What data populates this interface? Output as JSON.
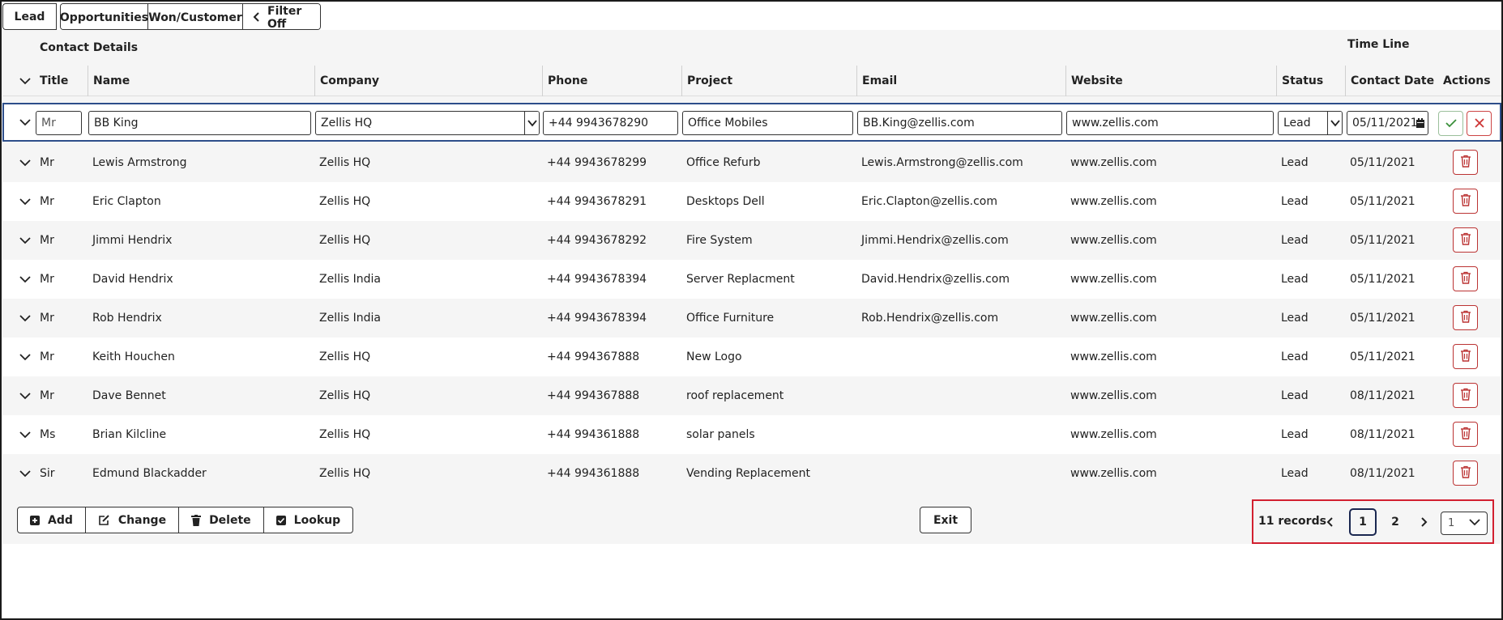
{
  "tabs": {
    "lead": "Lead",
    "opportunities": "Opportunities",
    "won": "Won/Customer",
    "filter": "Filter Off"
  },
  "groups": {
    "contact_details": "Contact Details",
    "time_line": "Time Line"
  },
  "headers": {
    "title": "Title",
    "name": "Name",
    "company": "Company",
    "phone": "Phone",
    "project": "Project",
    "email": "Email",
    "website": "Website",
    "status": "Status",
    "contact_date": "Contact Date",
    "actions": "Actions"
  },
  "edit": {
    "title": "Mr",
    "name": "BB King",
    "company": "Zellis HQ",
    "phone": "+44 9943678290",
    "project": "Office Mobiles",
    "email": "BB.King@zellis.com",
    "website": "www.zellis.com",
    "status": "Lead",
    "date": "05/11/2021"
  },
  "rows": [
    {
      "title": "Mr",
      "name": "Lewis Armstrong",
      "company": "Zellis HQ",
      "phone": "+44 9943678299",
      "project": "Office Refurb",
      "email": "Lewis.Armstrong@zellis.com",
      "website": "www.zellis.com",
      "status": "Lead",
      "date": "05/11/2021"
    },
    {
      "title": "Mr",
      "name": "Eric Clapton",
      "company": "Zellis HQ",
      "phone": "+44 9943678291",
      "project": "Desktops Dell",
      "email": "Eric.Clapton@zellis.com",
      "website": "www.zellis.com",
      "status": "Lead",
      "date": "05/11/2021"
    },
    {
      "title": "Mr",
      "name": "Jimmi Hendrix",
      "company": "Zellis HQ",
      "phone": "+44 9943678292",
      "project": "Fire System",
      "email": "Jimmi.Hendrix@zellis.com",
      "website": "www.zellis.com",
      "status": "Lead",
      "date": "05/11/2021"
    },
    {
      "title": "Mr",
      "name": "David Hendrix",
      "company": "Zellis India",
      "phone": "+44 9943678394",
      "project": "Server Replacment",
      "email": "David.Hendrix@zellis.com",
      "website": "www.zellis.com",
      "status": "Lead",
      "date": "05/11/2021"
    },
    {
      "title": "Mr",
      "name": "Rob Hendrix",
      "company": "Zellis India",
      "phone": "+44 9943678394",
      "project": "Office Furniture",
      "email": "Rob.Hendrix@zellis.com",
      "website": "www.zellis.com",
      "status": "Lead",
      "date": "05/11/2021"
    },
    {
      "title": "Mr",
      "name": "Keith Houchen",
      "company": "Zellis HQ",
      "phone": "+44 994367888",
      "project": "New Logo",
      "email": "",
      "website": "www.zellis.com",
      "status": "Lead",
      "date": "05/11/2021"
    },
    {
      "title": "Mr",
      "name": "Dave Bennet",
      "company": "Zellis HQ",
      "phone": "+44 994367888",
      "project": "roof replacement",
      "email": "",
      "website": "www.zellis.com",
      "status": "Lead",
      "date": "08/11/2021"
    },
    {
      "title": "Ms",
      "name": "Brian Kilcline",
      "company": "Zellis HQ",
      "phone": "+44 994361888",
      "project": "solar panels",
      "email": "",
      "website": "www.zellis.com",
      "status": "Lead",
      "date": "08/11/2021"
    },
    {
      "title": "Sir",
      "name": "Edmund Blackadder",
      "company": "Zellis HQ",
      "phone": "+44 994361888",
      "project": "Vending Replacement",
      "email": "",
      "website": "www.zellis.com",
      "status": "Lead",
      "date": "08/11/2021"
    }
  ],
  "footer": {
    "add": "Add",
    "change": "Change",
    "delete": "Delete",
    "lookup": "Lookup",
    "exit": "Exit"
  },
  "pager": {
    "records": "11 records",
    "page1": "1",
    "page2": "2",
    "select": "1"
  },
  "colors": {
    "accent": "#2d4e8a",
    "danger": "#b33333",
    "highlight": "#d22030",
    "ok": "#3a8f3a"
  }
}
